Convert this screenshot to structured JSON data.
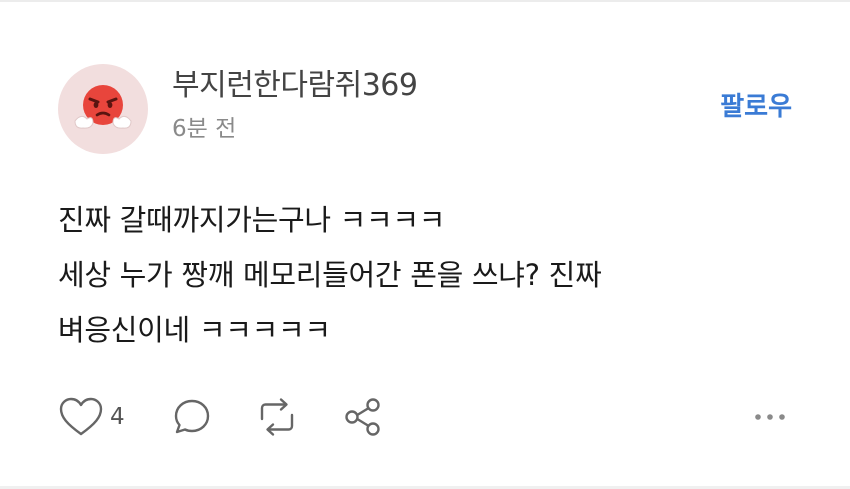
{
  "post": {
    "author": {
      "name": "부지런한다람쥐369",
      "avatar_icon": "fuming-face-icon"
    },
    "timestamp": "6분 전",
    "follow_label": "팔로우",
    "body_lines": [
      "진짜 갈때까지가는구나 ㅋㅋㅋㅋ",
      "세상 누가 짱깨 메모리들어간 폰을 쓰냐? 진짜",
      "벼응신이네 ㅋㅋㅋㅋㅋ"
    ],
    "actions": {
      "like_count": "4",
      "icons": [
        "heart-icon",
        "comment-icon",
        "repost-icon",
        "share-icon",
        "more-icon"
      ]
    }
  },
  "colors": {
    "accent": "#3a7bd5",
    "avatar_bg": "#f2dede",
    "avatar_face": "#e8453c",
    "icon_gray": "#666666"
  }
}
